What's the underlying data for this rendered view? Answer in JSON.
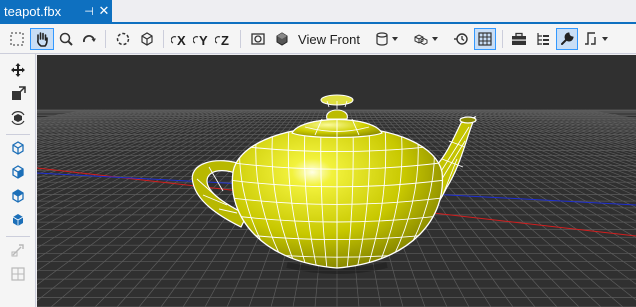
{
  "tab": {
    "title": "teapot.fbx",
    "pin_glyph": "⊣",
    "close_glyph": "✕"
  },
  "toolbar": {
    "view_label": "View Front"
  },
  "colors": {
    "accent": "#0e70c0",
    "toolbar_bg": "#f5f5f5",
    "viewport_bg": "#303030",
    "grid_line": "#5c5c5c",
    "axis_x": "#d21f1f",
    "axis_z": "#1f2fd2",
    "teapot_fill": "#d9d900",
    "wireframe": "#ffffff"
  }
}
